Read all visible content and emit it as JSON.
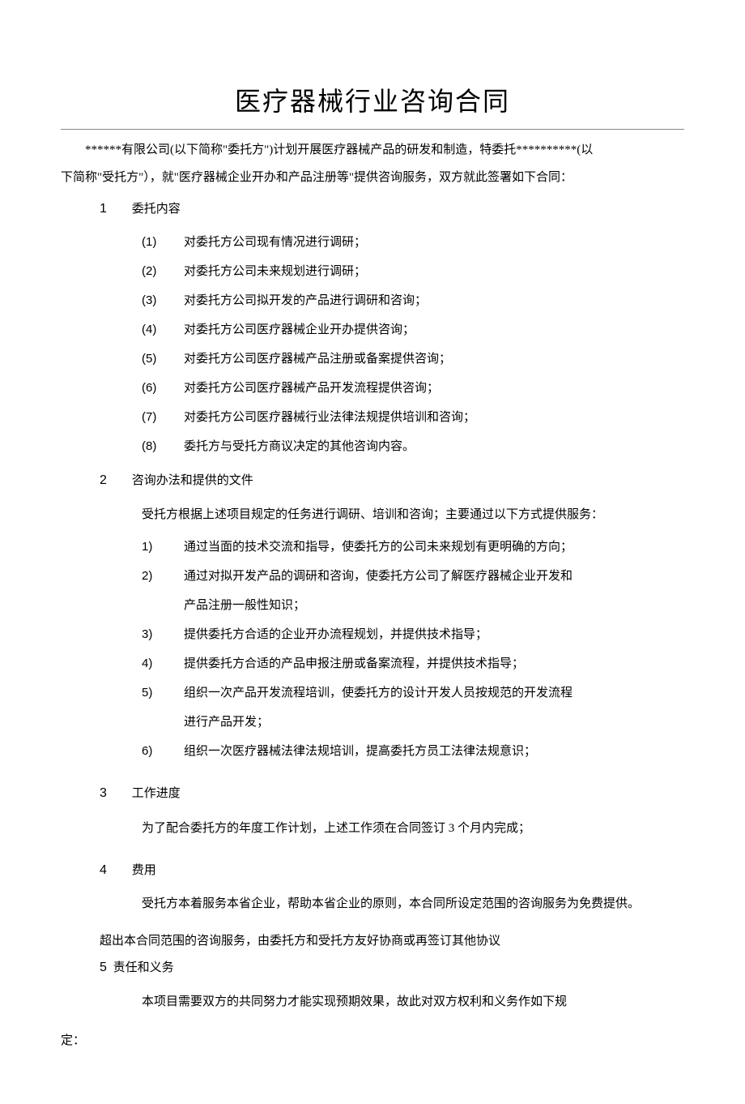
{
  "title": "医疗器械行业咨询合同",
  "intro1": "******有限公司(以下简称\"委托方\")计划开展医疗器械产品的研发和制造，特委托**********(以",
  "intro2": "下简称\"受托方\"），就\"医疗器械企业开办和产品注册等\"提供咨询服务，双方就此签署如下合同：",
  "sections": {
    "s1": {
      "num": "1",
      "title": "委托内容",
      "items": [
        {
          "num": "(1)",
          "text": "对委托方公司现有情况进行调研；"
        },
        {
          "num": "(2)",
          "text": "对委托方公司未来规划进行调研；"
        },
        {
          "num": "(3)",
          "text": "对委托方公司拟开发的产品进行调研和咨询；"
        },
        {
          "num": "(4)",
          "text": "对委托方公司医疗器械企业开办提供咨询；"
        },
        {
          "num": "(5)",
          "text": "对委托方公司医疗器械产品注册或备案提供咨询；"
        },
        {
          "num": "(6)",
          "text": "对委托方公司医疗器械产品开发流程提供咨询；"
        },
        {
          "num": "(7)",
          "text": "对委托方公司医疗器械行业法律法规提供培训和咨询；"
        },
        {
          "num": "(8)",
          "text": "委托方与受托方商议决定的其他咨询内容。"
        }
      ]
    },
    "s2": {
      "num": "2",
      "title": "咨询办法和提供的文件",
      "lead": "受托方根据上述项目规定的任务进行调研、培训和咨询；主要通过以下方式提供服务：",
      "items": [
        {
          "num": "1)",
          "text": "通过当面的技术交流和指导，使委托方的公司未来规划有更明确的方向；"
        },
        {
          "num": "2)",
          "text": "通过对拟开发产品的调研和咨询，使委托方公司了解医疗器械企业开发和",
          "cont": "产品注册一般性知识；"
        },
        {
          "num": "3)",
          "text": "提供委托方合适的企业开办流程规划，并提供技术指导；"
        },
        {
          "num": "4)",
          "text": "提供委托方合适的产品申报注册或备案流程，并提供技术指导；"
        },
        {
          "num": "5)",
          "text": "组织一次产品开发流程培训，使委托方的设计开发人员按规范的开发流程",
          "cont": "进行产品开发；"
        },
        {
          "num": "6)",
          "text": "组织一次医疗器械法律法规培训，提高委托方员工法律法规意识；"
        }
      ]
    },
    "s3": {
      "num": "3",
      "title": "工作进度",
      "body": "为了配合委托方的年度工作计划，上述工作须在合同签订 3 个月内完成；"
    },
    "s4": {
      "num": "4",
      "title": "费用",
      "body1": "受托方本着服务本省企业，帮助本省企业的原则，本合同所设定范围的咨询服务为免费提供。",
      "body2": "超出本合同范围的咨询服务，由委托方和受托方友好协商或再签订其他协议"
    },
    "s5": {
      "num": "5",
      "title": "责任和义务",
      "body": "本项目需要双方的共同努力才能实现预期效果，故此对双方权利和义务作如下规",
      "cont": "定："
    }
  }
}
